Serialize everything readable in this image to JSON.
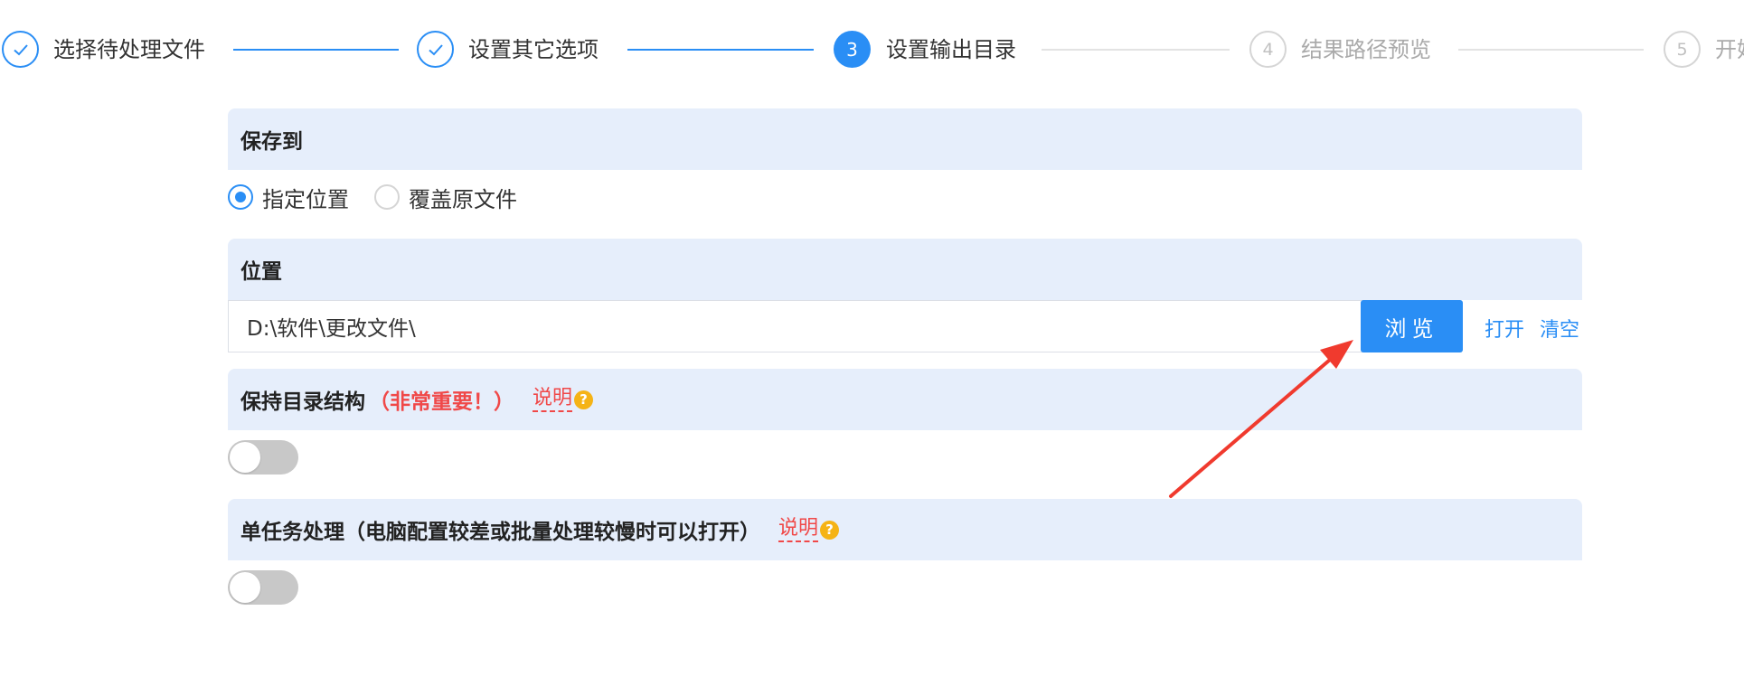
{
  "stepper": {
    "steps": [
      {
        "index": "1",
        "label": "选择待处理文件",
        "state": "done"
      },
      {
        "index": "2",
        "label": "设置其它选项",
        "state": "done"
      },
      {
        "index": "3",
        "label": "设置输出目录",
        "state": "active"
      },
      {
        "index": "4",
        "label": "结果路径预览",
        "state": "pending"
      },
      {
        "index": "5",
        "label": "开始处理",
        "state": "pending"
      }
    ]
  },
  "save_to": {
    "title": "保存到",
    "options": [
      {
        "label": "指定位置",
        "checked": true
      },
      {
        "label": "覆盖原文件",
        "checked": false
      }
    ]
  },
  "location": {
    "title": "位置",
    "path_value": "D:\\软件\\更改文件\\",
    "browse_label": "浏览",
    "open_label": "打开",
    "clear_label": "清空"
  },
  "keep_structure": {
    "title": "保持目录结构",
    "note": "（非常重要！）",
    "help_label": "说明",
    "help_badge": "?",
    "enabled": false
  },
  "single_task": {
    "title": "单任务处理（电脑配置较差或批量处理较慢时可以打开）",
    "help_label": "说明",
    "help_badge": "?",
    "enabled": false
  },
  "colors": {
    "accent": "#2a8ef5",
    "section_bg": "#e6eefb",
    "warning_red": "#f04848",
    "help_badge": "#f5b315",
    "annotation_arrow": "#f03a2e"
  },
  "icons": {
    "done_step": "check-icon",
    "help": "question-icon"
  }
}
